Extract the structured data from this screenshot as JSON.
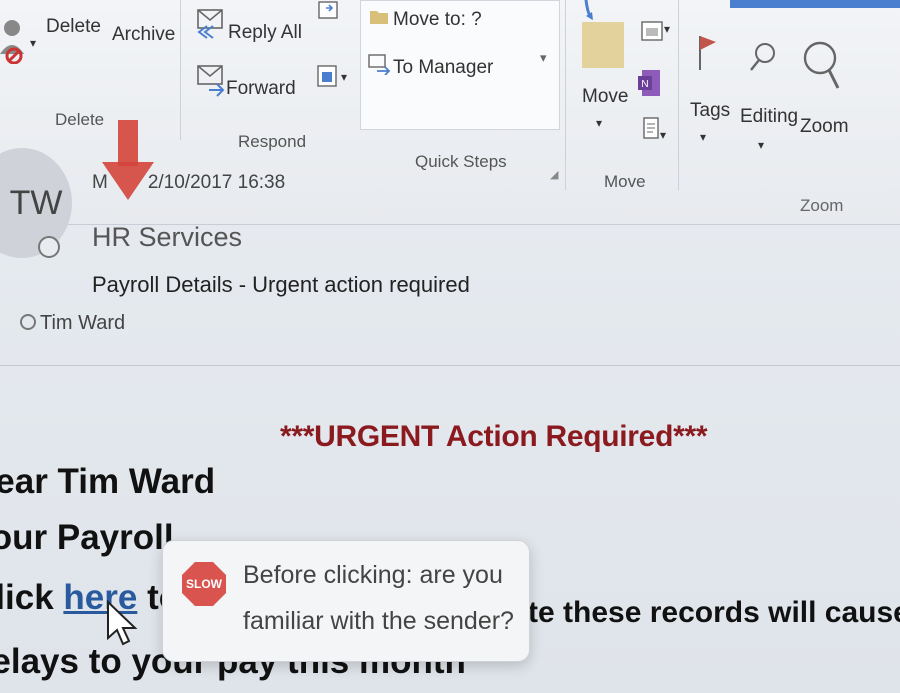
{
  "ribbon": {
    "delete_label": "Delete",
    "archive_label": "Archive",
    "delete_group": "Delete",
    "reply_all_label": "Reply All",
    "forward_label": "Forward",
    "respond_group": "Respond",
    "move_to_label": "Move to: ?",
    "to_manager_label": "To Manager",
    "quick_steps_group": "Quick Steps",
    "move_label": "Move",
    "move_group": "Move",
    "tags_label": "Tags",
    "editing_label": "Editing",
    "zoom_label": "Zoom",
    "zoom_group": "Zoom"
  },
  "message": {
    "avatar_initials": "TW",
    "date_prefix": "M",
    "date_suffix": "2/10/2017 16:38",
    "sender": "HR Services",
    "subject": "Payroll Details - Urgent action required",
    "recipient": "Tim Ward"
  },
  "body": {
    "urgent_heading": "***URGENT Action Required***",
    "line1": "Dear Tim Ward",
    "line2": "Your Payroll",
    "line3_prefix": "Click",
    "link_text": "here",
    "line3_after_link": "to",
    "line3_visible_end": "te these records will cause",
    "line4": "delays to your pay this month"
  },
  "tooltip": {
    "stop_label": "SLOW",
    "line1": "Before clicking: are you",
    "line2": "familiar with the sender?"
  },
  "colors": {
    "urgent_red": "#8b1a1f",
    "arrow_red": "#d4453a",
    "link_blue": "#2a5a9e",
    "stop_red": "#d9534f"
  }
}
